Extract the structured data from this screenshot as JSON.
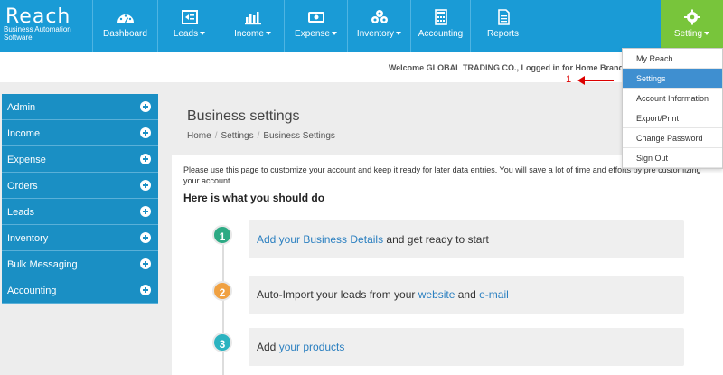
{
  "brand": {
    "name": "Reach",
    "tagline": "Business Automation Software"
  },
  "nav": [
    {
      "label": "Dashboard",
      "icon": "dashboard-gauge-icon",
      "dropdown": false
    },
    {
      "label": "Leads",
      "icon": "leads-icon",
      "dropdown": true
    },
    {
      "label": "Income",
      "icon": "income-chart-icon",
      "dropdown": true
    },
    {
      "label": "Expense",
      "icon": "expense-money-icon",
      "dropdown": true
    },
    {
      "label": "Inventory",
      "icon": "inventory-cubes-icon",
      "dropdown": true
    },
    {
      "label": "Accounting",
      "icon": "calculator-icon",
      "dropdown": false
    },
    {
      "label": "Reports",
      "icon": "report-document-icon",
      "dropdown": false
    },
    {
      "label": "Setting",
      "icon": "gear-icon",
      "dropdown": true
    }
  ],
  "welcome": "Welcome GLOBAL TRADING CO., Logged in for Home Brand",
  "sidebar": [
    {
      "label": "Admin"
    },
    {
      "label": "Income"
    },
    {
      "label": "Expense"
    },
    {
      "label": "Orders"
    },
    {
      "label": "Leads"
    },
    {
      "label": "Inventory"
    },
    {
      "label": "Bulk Messaging"
    },
    {
      "label": "Accounting"
    }
  ],
  "page": {
    "title": "Business settings",
    "breadcrumb": [
      "Home",
      "Settings",
      "Business Settings"
    ],
    "intro": "Please use this page to customize your account and keep it ready for later data entries. You will save a lot of time and efforts by pre customizing your account.",
    "howto": "Here is what you should do"
  },
  "steps": [
    {
      "num": "1",
      "color": "#2daa84",
      "parts": {
        "a": "Add your Business Details",
        "b": " and get ready to start",
        "c": "",
        "d": ""
      }
    },
    {
      "num": "2",
      "color": "#f0a142",
      "parts": {
        "a": "Auto-Import your leads from your ",
        "b": "website",
        "c": " and ",
        "d": "e-mail"
      }
    },
    {
      "num": "3",
      "color": "#2bb3c0",
      "parts": {
        "a": "Add ",
        "b": "your products",
        "c": "",
        "d": ""
      }
    }
  ],
  "dropdown": {
    "items": [
      "My Reach",
      "Settings",
      "Account Information",
      "Export/Print",
      "Change Password",
      "Sign Out"
    ],
    "active_index": 1
  },
  "annotation": {
    "label": "1",
    "color": "#dd0000"
  }
}
